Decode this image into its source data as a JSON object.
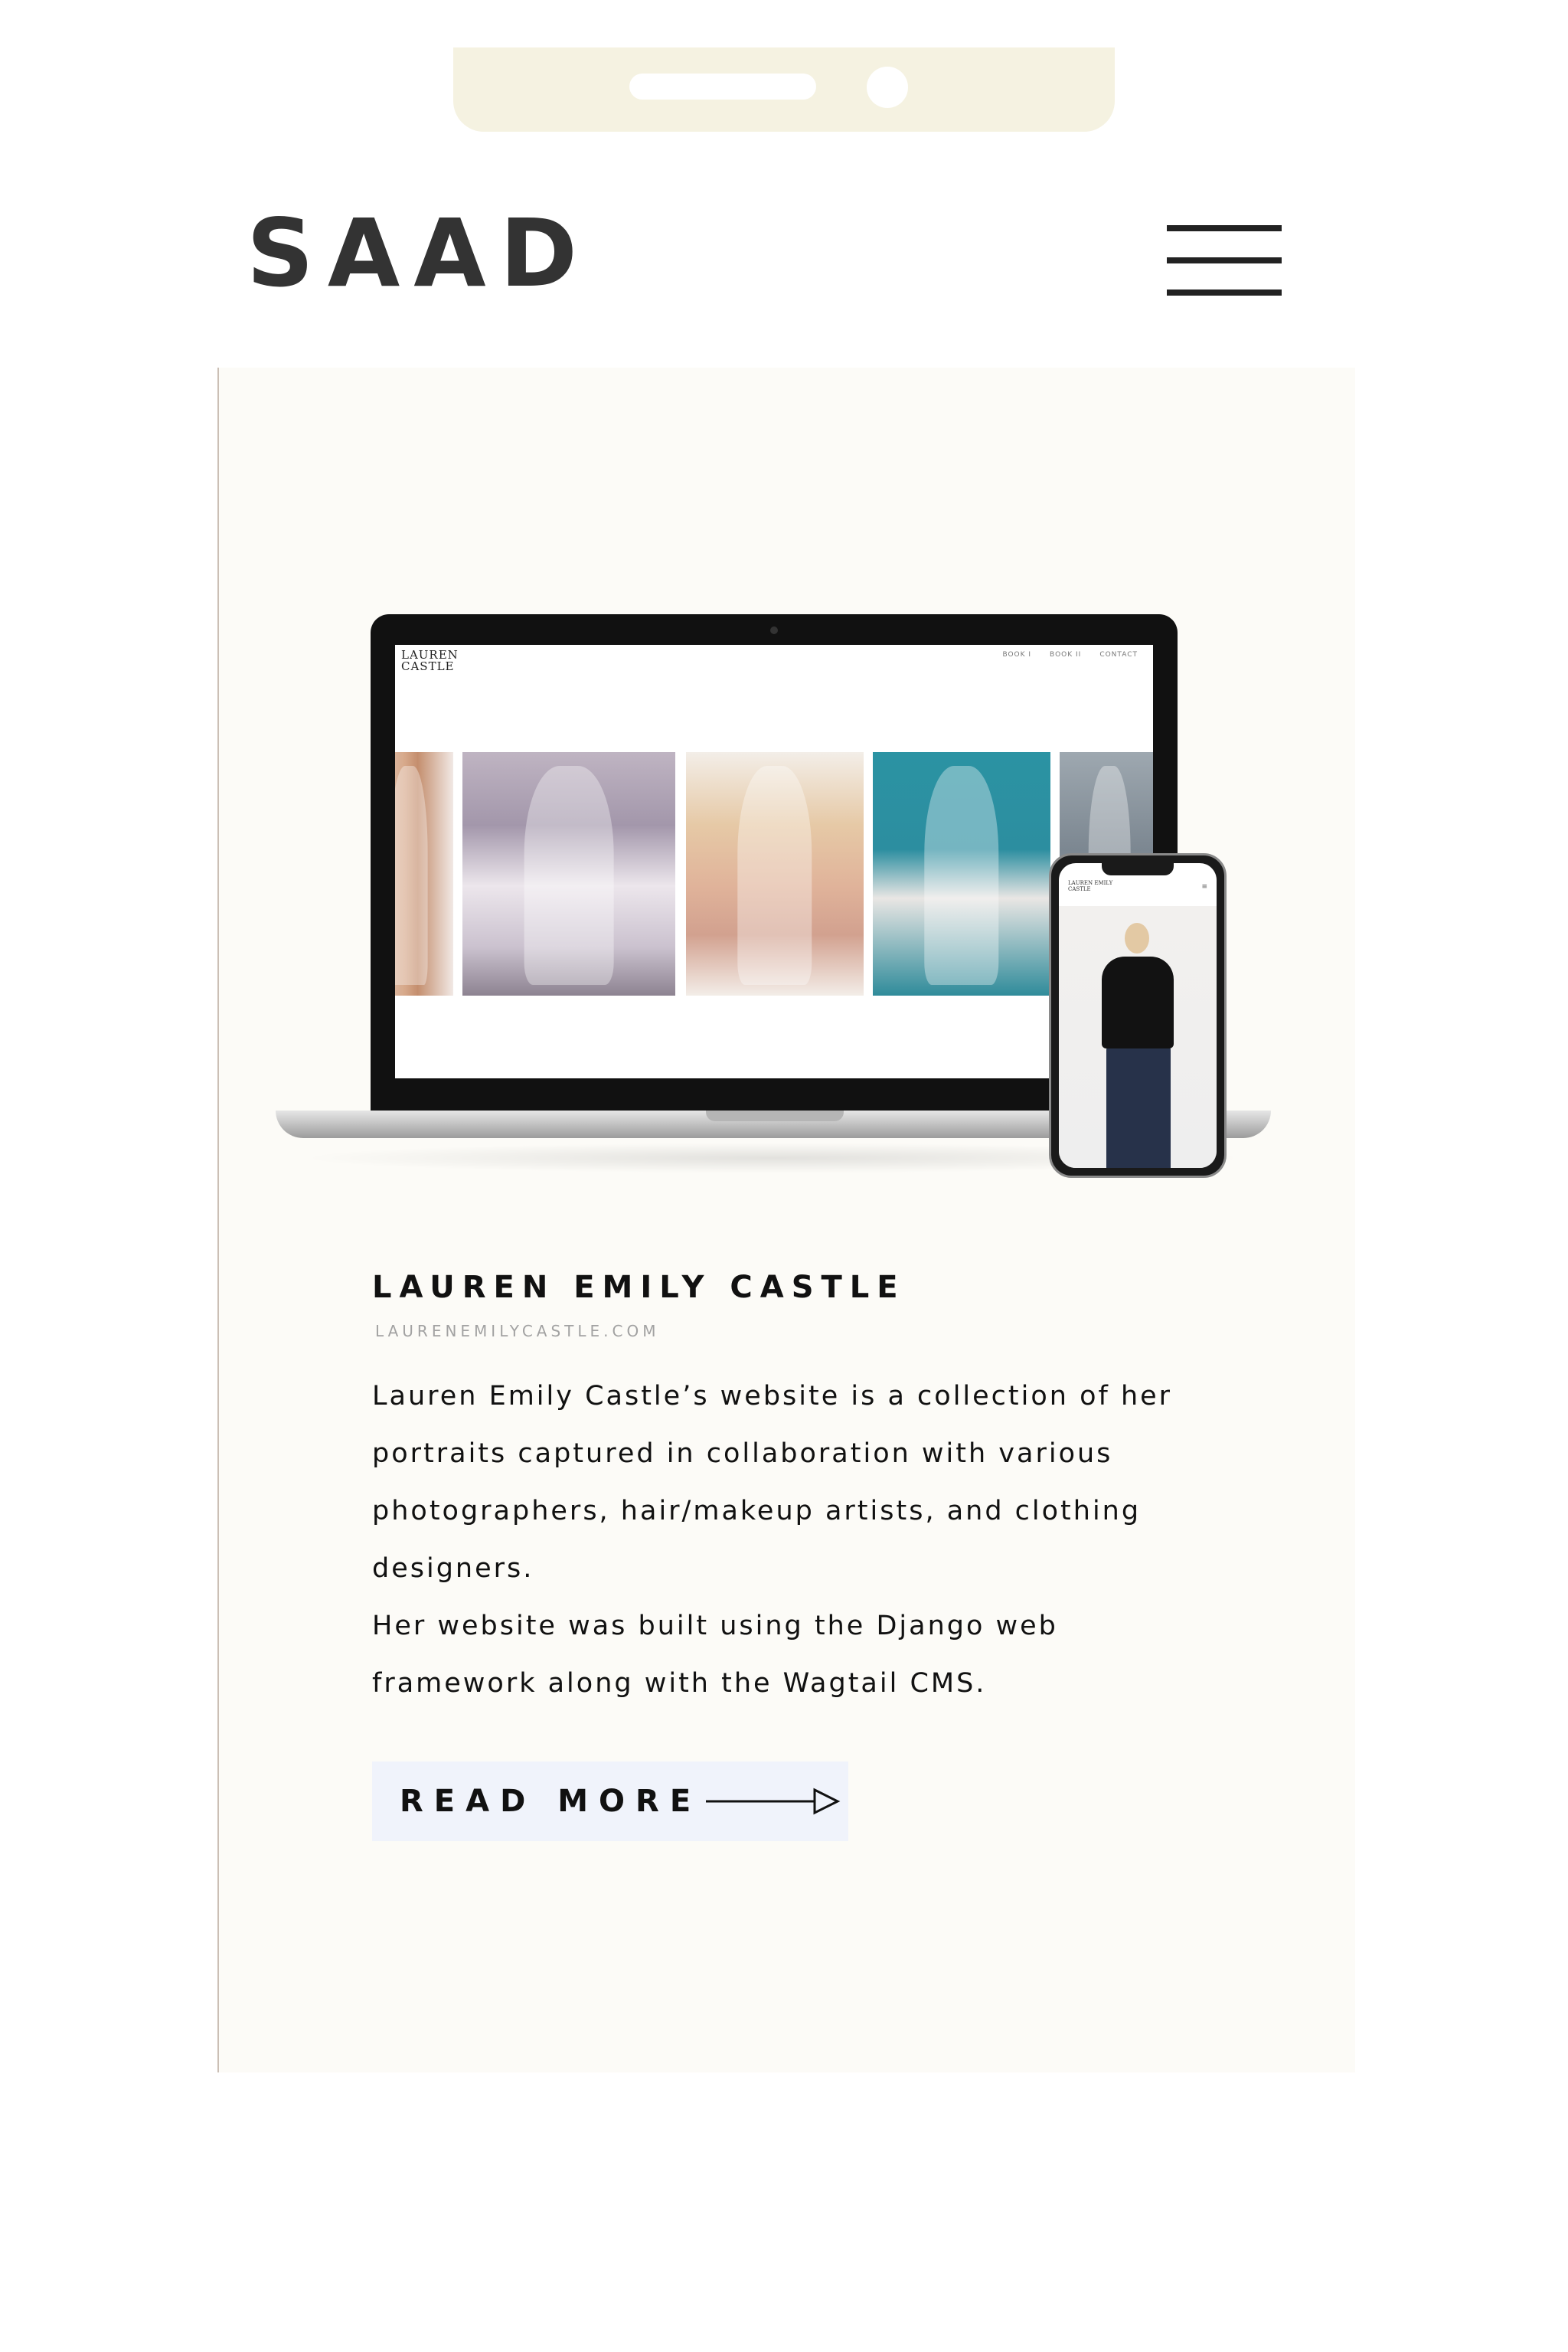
{
  "header": {
    "logo": "SAAD"
  },
  "project": {
    "mockup": {
      "laptop": {
        "site_logo": "LAUREN CASTLE",
        "nav": [
          "BOOK I",
          "BOOK II",
          "CONTACT"
        ]
      },
      "phone": {
        "site_logo": "LAUREN EMILY CASTLE"
      }
    },
    "title": "LAUREN EMILY CASTLE",
    "url": "LAURENEMILYCASTLE.COM",
    "description": [
      "Lauren Emily Castle’s website is a collection of her portraits captured in collaboration with various photographers, hair/makeup artists, and clothing designers.",
      "Her website was built using the Django web framework along with the Wagtail CMS."
    ],
    "read_more_label": "READ MORE"
  },
  "icons": {
    "menu": "hamburger-menu-icon",
    "arrow": "arrow-right-icon"
  },
  "colors": {
    "notch": "#f5f2e1",
    "card_background": "#fcfbf7",
    "button_background": "#f0f3fb",
    "logo": "#333333",
    "url_text": "#a2a2a2"
  }
}
